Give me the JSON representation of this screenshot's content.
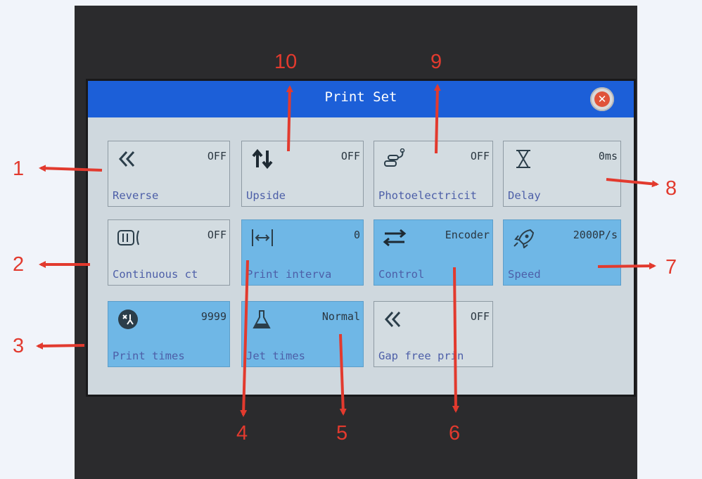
{
  "window": {
    "title": "Print Set",
    "close_icon": "close-icon"
  },
  "tiles": [
    {
      "id": "reverse",
      "label": "Reverse",
      "value": "OFF",
      "icon": "double-chevron-left-icon",
      "active": false
    },
    {
      "id": "upside",
      "label": "Upside",
      "value": "OFF",
      "icon": "up-down-arrows-icon",
      "active": false
    },
    {
      "id": "photoelectricity",
      "label": "Photoelectricit",
      "value": "OFF",
      "icon": "photoelectric-sensor-icon",
      "active": false
    },
    {
      "id": "delay",
      "label": "Delay",
      "value": "0ms",
      "icon": "hourglass-icon",
      "active": false
    },
    {
      "id": "continuous",
      "label": "Continuous ct",
      "value": "OFF",
      "icon": "continuous-print-icon",
      "active": false
    },
    {
      "id": "print-interval",
      "label": "Print interva",
      "value": "0",
      "icon": "interval-arrows-icon",
      "active": true
    },
    {
      "id": "control",
      "label": "Control",
      "value": "Encoder",
      "icon": "encoder-arrows-icon",
      "active": true
    },
    {
      "id": "speed",
      "label": "Speed",
      "value": "2000P/s",
      "icon": "rocket-icon",
      "active": true
    },
    {
      "id": "print-times",
      "label": "Print times",
      "value": "9999",
      "icon": "print-times-icon",
      "active": true
    },
    {
      "id": "jet-times",
      "label": "Jet times",
      "value": "Normal",
      "icon": "flask-icon",
      "active": true
    },
    {
      "id": "gap-free",
      "label": "Gap free prin",
      "value": "OFF",
      "icon": "double-chevron-left-icon",
      "active": false
    }
  ],
  "callouts": {
    "c1": "1",
    "c2": "2",
    "c3": "3",
    "c4": "4",
    "c5": "5",
    "c6": "6",
    "c7": "7",
    "c8": "8",
    "c9": "9",
    "c10": "10"
  },
  "colors": {
    "titlebar": "#1c5fd8",
    "active_tile": "#6fb7e6",
    "inactive_tile": "#d3dce1",
    "label_text": "#4d5fa8",
    "callout_red": "#e23a2e"
  }
}
